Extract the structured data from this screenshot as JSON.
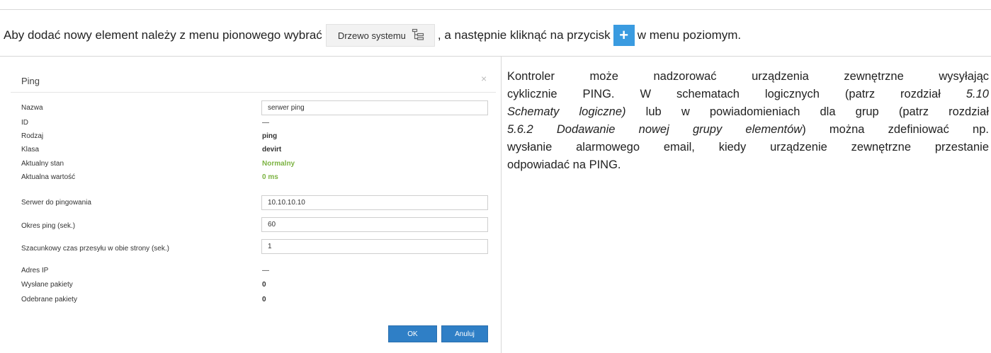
{
  "instruction": {
    "part1": "Aby dodać nowy element należy z menu pionowego wybrać",
    "menu_item_label": "Drzewo systemu",
    "part2": ", a następnie kliknąć na przycisk",
    "plus_symbol": "+",
    "part3": "w menu poziomym."
  },
  "modal": {
    "title": "Ping",
    "close_symbol": "×",
    "rows": [
      {
        "label": "Nazwa",
        "value": "serwer ping"
      },
      {
        "label": "ID",
        "value": "—"
      },
      {
        "label": "Rodzaj",
        "value": "ping"
      },
      {
        "label": "Klasa",
        "value": "devirt"
      },
      {
        "label": "Aktualny stan",
        "value": "Normalny"
      },
      {
        "label": "Aktualna wartość",
        "value": "0 ms"
      },
      {
        "label": "Serwer do pingowania",
        "value": "10.10.10.10"
      },
      {
        "label": "Okres ping (sek.)",
        "value": "60"
      },
      {
        "label": "Szacunkowy czas przesyłu w obie strony (sek.)",
        "value": "1"
      },
      {
        "label": "Adres IP",
        "value": "—"
      },
      {
        "label": "Wysłane pakiety",
        "value": "0"
      },
      {
        "label": "Odebrane pakiety",
        "value": "0"
      }
    ],
    "ok_label": "OK",
    "cancel_label": "Anuluj"
  },
  "description": {
    "l1": "Kontroler może nadzorować urządzenia zewnętrzne wysyłając",
    "l2a": "cyklicznie PING. W schematach logicznych (patrz rozdział",
    "l2b": "5.10",
    "l3a": "Schematy logiczne)",
    "l3b": "lub w powiadomieniach dla grup (patrz rozdział",
    "l4a": "5.6.2 Dodawanie nowej grupy elementów",
    "l4b": ") można zdefiniować np.",
    "l5": "wysłanie alarmowego email, kiedy urządzenie zewnętrzne przestanie",
    "l6": "odpowiadać na PING."
  },
  "colors": {
    "accent": "#3a9be0",
    "button": "#2f7fc6",
    "status_ok": "#7cb342"
  }
}
